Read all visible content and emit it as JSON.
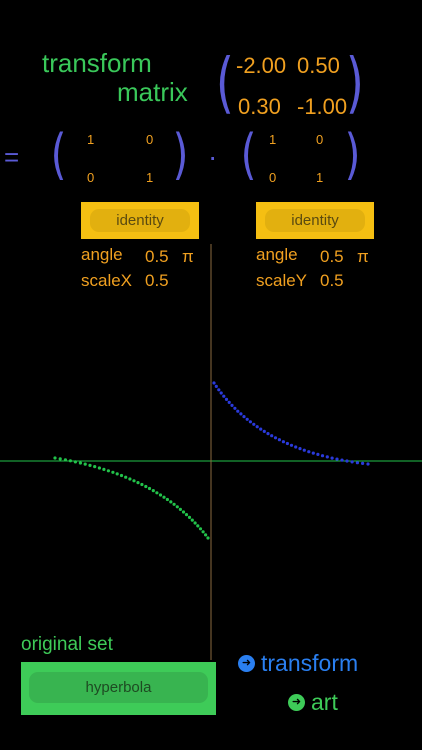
{
  "header": {
    "title_line1": "transform",
    "title_line2": "matrix"
  },
  "transform_matrix": {
    "a": "-2.00",
    "b": "0.50",
    "c": "0.30",
    "d": "-1.00"
  },
  "equals_sign": "=",
  "dot_operator": "·",
  "left_matrix": {
    "a": "1",
    "b": "0",
    "c": "0",
    "d": "1"
  },
  "right_matrix": {
    "a": "1",
    "b": "0",
    "c": "0",
    "d": "1"
  },
  "left_panel": {
    "button": "identity",
    "angle_label": "angle",
    "angle_value": "0.5",
    "angle_unit": "π",
    "scale_label": "scaleX",
    "scale_value": "0.5"
  },
  "right_panel": {
    "button": "identity",
    "angle_label": "angle",
    "angle_value": "0.5",
    "angle_unit": "π",
    "scale_label": "scaleY",
    "scale_value": "0.5"
  },
  "original_set": {
    "label": "original set",
    "button": "hyperbola"
  },
  "links": {
    "transform": "transform",
    "art": "art",
    "link_icon": "arrow-circle-icon"
  },
  "colors": {
    "title": "#3ac85a",
    "numbers": "#f0a020",
    "paren": "#5a5ad6",
    "button_yellow": "#f5bf12",
    "button_green": "#3ecb58",
    "link_blue": "#2a7ff0",
    "original_points": "#22c24a",
    "transformed_points": "#2a3adc",
    "axis_x": "#22c24a",
    "axis_y": "#8a6a40"
  }
}
